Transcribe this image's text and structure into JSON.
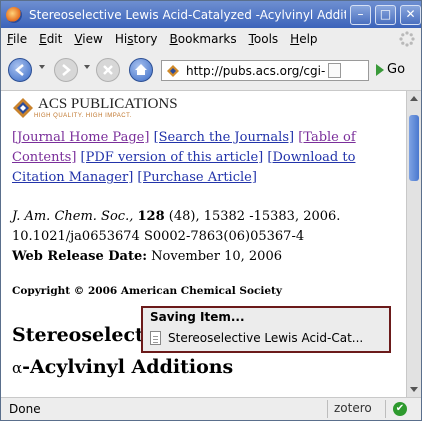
{
  "window": {
    "title": "Stereoselective Lewis Acid-Catalyzed -Acylvinyl Additions"
  },
  "titlebar_buttons": {
    "minimize": "–",
    "maximize": "□",
    "close": "✕"
  },
  "menu": [
    "File",
    "Edit",
    "View",
    "History",
    "Bookmarks",
    "Tools",
    "Help"
  ],
  "menu_mnemonics": [
    "F",
    "E",
    "V",
    "s",
    "B",
    "T",
    "H"
  ],
  "navbar": {
    "url": "http://pubs.acs.org/cgi-",
    "go_label": "Go"
  },
  "content": {
    "logo": {
      "name": "ACS PUBLICATIONS",
      "tagline": "HIGH QUALITY. HIGH IMPACT."
    },
    "links": [
      {
        "label": "[Journal Home Page]",
        "visited": true
      },
      {
        "label": "[Search the Journals]",
        "visited": false
      },
      {
        "label": "[Table of Contents]",
        "visited": true
      },
      {
        "label": "[PDF version of this article]",
        "visited": false
      },
      {
        "label": "[Download to Citation Manager]",
        "visited": false
      },
      {
        "label": "[Purchase Article]",
        "visited": false
      }
    ],
    "citation": {
      "journal": "J. Am. Chem. Soc.,",
      "volume": "128",
      "issue_pages": " (48), 15382 -15383, 2006.",
      "doi_line": "10.1021/ja0653674 S0002-7863(06)05367-4",
      "release_label": "Web Release Date:",
      "release_date": " November 10, 2006"
    },
    "copyright": "Copyright © 2006 American Chemical Society",
    "article_title_line1": "Stereoselective",
    "article_title_line2_prefix": "α",
    "article_title_line2": "-Acylvinyl Additions"
  },
  "popup": {
    "title": "Saving Item...",
    "item": "Stereoselective Lewis Acid-Cat..."
  },
  "statusbar": {
    "status": "Done",
    "zotero": "zotero",
    "ok_icon": "✔"
  },
  "colors": {
    "link": "#2233aa",
    "visited": "#7a2e9a",
    "popup_border": "#6b1a1a",
    "titlebar": "#3b63ba"
  }
}
